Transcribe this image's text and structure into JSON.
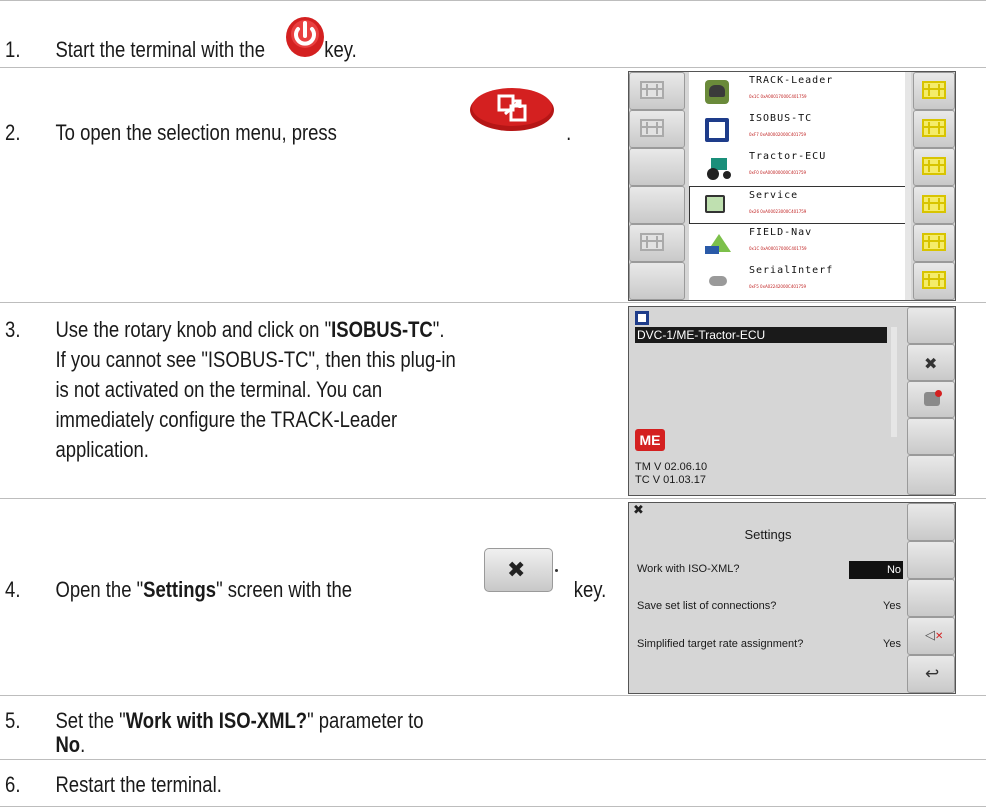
{
  "steps": [
    {
      "num": "1.",
      "pre": "Start the terminal with the",
      "post": "key."
    },
    {
      "num": "2.",
      "text": "To open the selection menu, press",
      "post": "."
    },
    {
      "num": "3.",
      "lines_pre": "Use the rotary knob and click on \"",
      "bold": "ISOBUS-TC",
      "lines_post": "\".",
      "more": [
        "If you cannot see \"ISOBUS-TC\", then this plug-in",
        "is not activated on the terminal. You can",
        "immediately configure the TRACK-Leader",
        "application."
      ]
    },
    {
      "num": "4.",
      "pre": "Open the \"",
      "bold": "Settings",
      "mid": "\" screen with the",
      "post": "key."
    },
    {
      "num": "5.",
      "pre": "Set the \"",
      "bold": "Work with ISO-XML?",
      "post": "\" parameter to",
      "line2_bold": "No",
      "line2_post": "."
    },
    {
      "num": "6.",
      "text": "Restart the terminal."
    }
  ],
  "menu": {
    "plugins": [
      {
        "name": "TRACK-Leader",
        "addr": "0x1C 0xA00017000C401759",
        "icon": "track-leader-icon"
      },
      {
        "name": "ISOBUS-TC",
        "addr": "0xF7 0xA00002000C401759",
        "icon": "isobus-tc-icon"
      },
      {
        "name": "Tractor-ECU",
        "addr": "0xF0 0xA00000000C401759",
        "icon": "tractor-icon"
      },
      {
        "name": "Service",
        "addr": "0x26 0xA00023000C401759",
        "icon": "service-icon"
      },
      {
        "name": "FIELD-Nav",
        "addr": "0x1C 0xA00017000C401759",
        "icon": "field-nav-icon"
      },
      {
        "name": "SerialInterf",
        "addr": "0xF5 0xA02242000C401759",
        "icon": "serial-interface-icon"
      }
    ],
    "selected": "Service"
  },
  "tc_screen": {
    "list_item": "DVC-1/ME-Tractor-ECU",
    "brand": "ME",
    "version_tm": "TM V 02.06.10",
    "version_tc": "TC V 01.03.17"
  },
  "settings_screen": {
    "title": "Settings",
    "rows": [
      {
        "label": "Work with ISO-XML?",
        "value": "No",
        "highlight": true
      },
      {
        "label": "Save set list of connections?",
        "value": "Yes",
        "highlight": false
      },
      {
        "label": "Simplified target rate assignment?",
        "value": "Yes",
        "highlight": false
      }
    ]
  },
  "colors": {
    "power_key": "#d42020",
    "selection_key": "#d42020",
    "settings_value_bg": "#111111",
    "list_highlight": "#1a1a1a"
  }
}
